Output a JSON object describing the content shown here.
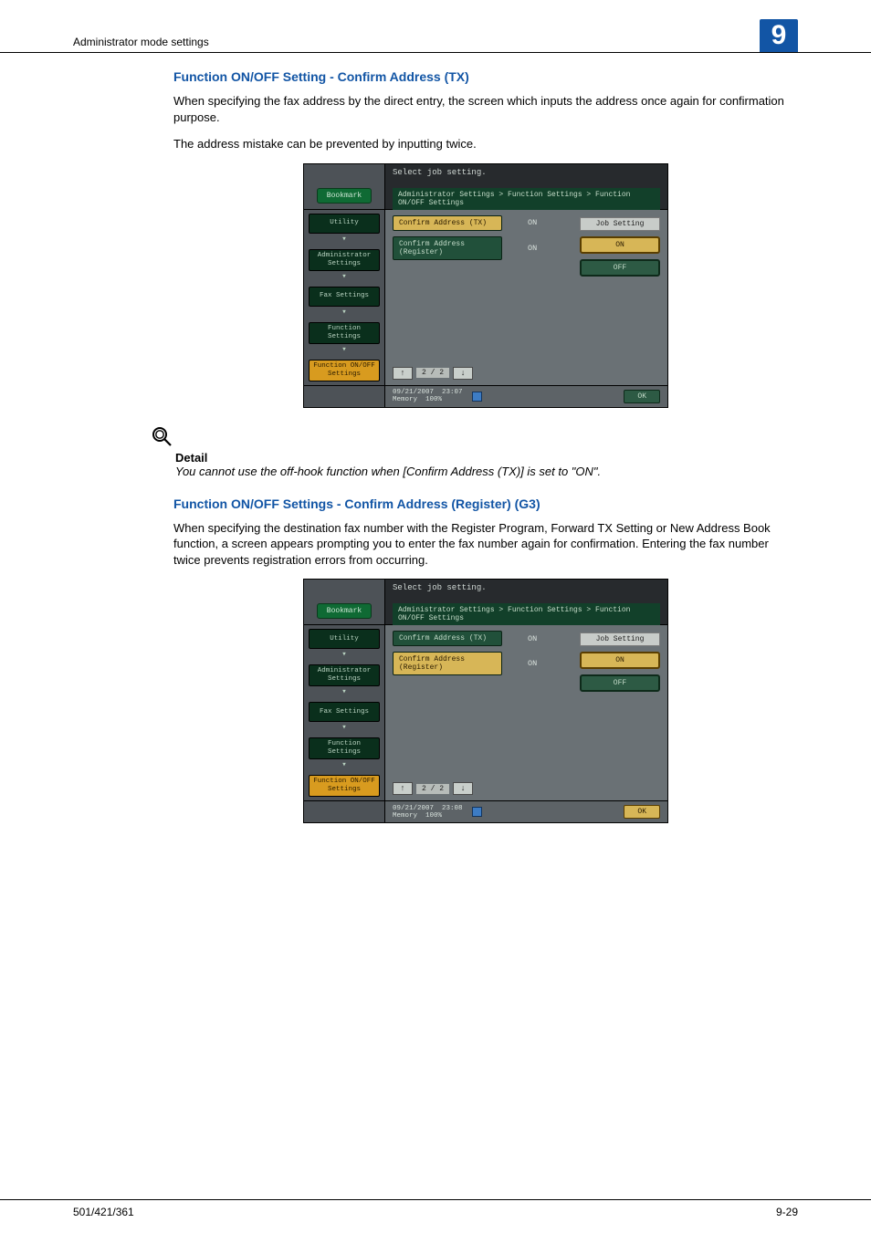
{
  "header": {
    "section": "Administrator mode settings",
    "chapter": "9"
  },
  "sections": [
    {
      "heading": "Function ON/OFF Setting - Confirm Address (TX)",
      "paragraphs": [
        "When specifying the fax address by the direct entry, the screen which inputs the address once again for confirmation purpose.",
        "The address mistake can be prevented by inputting twice."
      ],
      "panel": {
        "select_label": "Select job setting.",
        "bookmark": "Bookmark",
        "breadcrumb": "Administrator Settings > Function Settings > Function ON/OFF Settings",
        "nav": [
          {
            "label": "Utility",
            "active": false,
            "arrow": true
          },
          {
            "label": "Administrator Settings",
            "active": false,
            "arrow": true
          },
          {
            "label": "Fax Settings",
            "active": false,
            "arrow": true
          },
          {
            "label": "Function Settings",
            "active": false,
            "arrow": true
          },
          {
            "label": "Function ON/OFF Settings",
            "active": true,
            "arrow": false
          }
        ],
        "rows": [
          {
            "label": "Confirm Address (TX)",
            "value": "ON",
            "selected": true
          },
          {
            "label": "Confirm Address (Register)",
            "value": "ON",
            "selected": false
          }
        ],
        "pager": "2 /  2",
        "right": {
          "title": "Job Setting",
          "on": "ON",
          "off": "OFF"
        },
        "status": {
          "date": "09/21/2007",
          "time": "23:07",
          "mem_label": "Memory",
          "mem_value": "100%"
        },
        "ok": "OK",
        "ok_highlight": false
      }
    },
    {
      "heading": "Function ON/OFF Settings - Confirm Address (Register) (G3)",
      "paragraphs": [
        "When specifying the destination fax number with the Register Program, Forward TX Setting or New Address Book function, a screen appears prompting you to enter the fax number again for confirmation. Entering the fax number twice prevents registration errors from occurring."
      ],
      "panel": {
        "select_label": "Select job setting.",
        "bookmark": "Bookmark",
        "breadcrumb": "Administrator Settings > Function Settings > Function ON/OFF Settings",
        "nav": [
          {
            "label": "Utility",
            "active": false,
            "arrow": true
          },
          {
            "label": "Administrator Settings",
            "active": false,
            "arrow": true
          },
          {
            "label": "Fax Settings",
            "active": false,
            "arrow": true
          },
          {
            "label": "Function Settings",
            "active": false,
            "arrow": true
          },
          {
            "label": "Function ON/OFF Settings",
            "active": true,
            "arrow": false
          }
        ],
        "rows": [
          {
            "label": "Confirm Address (TX)",
            "value": "ON",
            "selected": false
          },
          {
            "label": "Confirm Address (Register)",
            "value": "ON",
            "selected": true
          }
        ],
        "pager": "2 /  2",
        "right": {
          "title": "Job Setting",
          "on": "ON",
          "off": "OFF"
        },
        "status": {
          "date": "09/21/2007",
          "time": "23:08",
          "mem_label": "Memory",
          "mem_value": "100%"
        },
        "ok": "OK",
        "ok_highlight": true
      }
    }
  ],
  "detail": {
    "title": "Detail",
    "body": "You cannot use the off-hook function when [Confirm Address (TX)] is set to \"ON\"."
  },
  "footer": {
    "left": "501/421/361",
    "right": "9-29"
  }
}
